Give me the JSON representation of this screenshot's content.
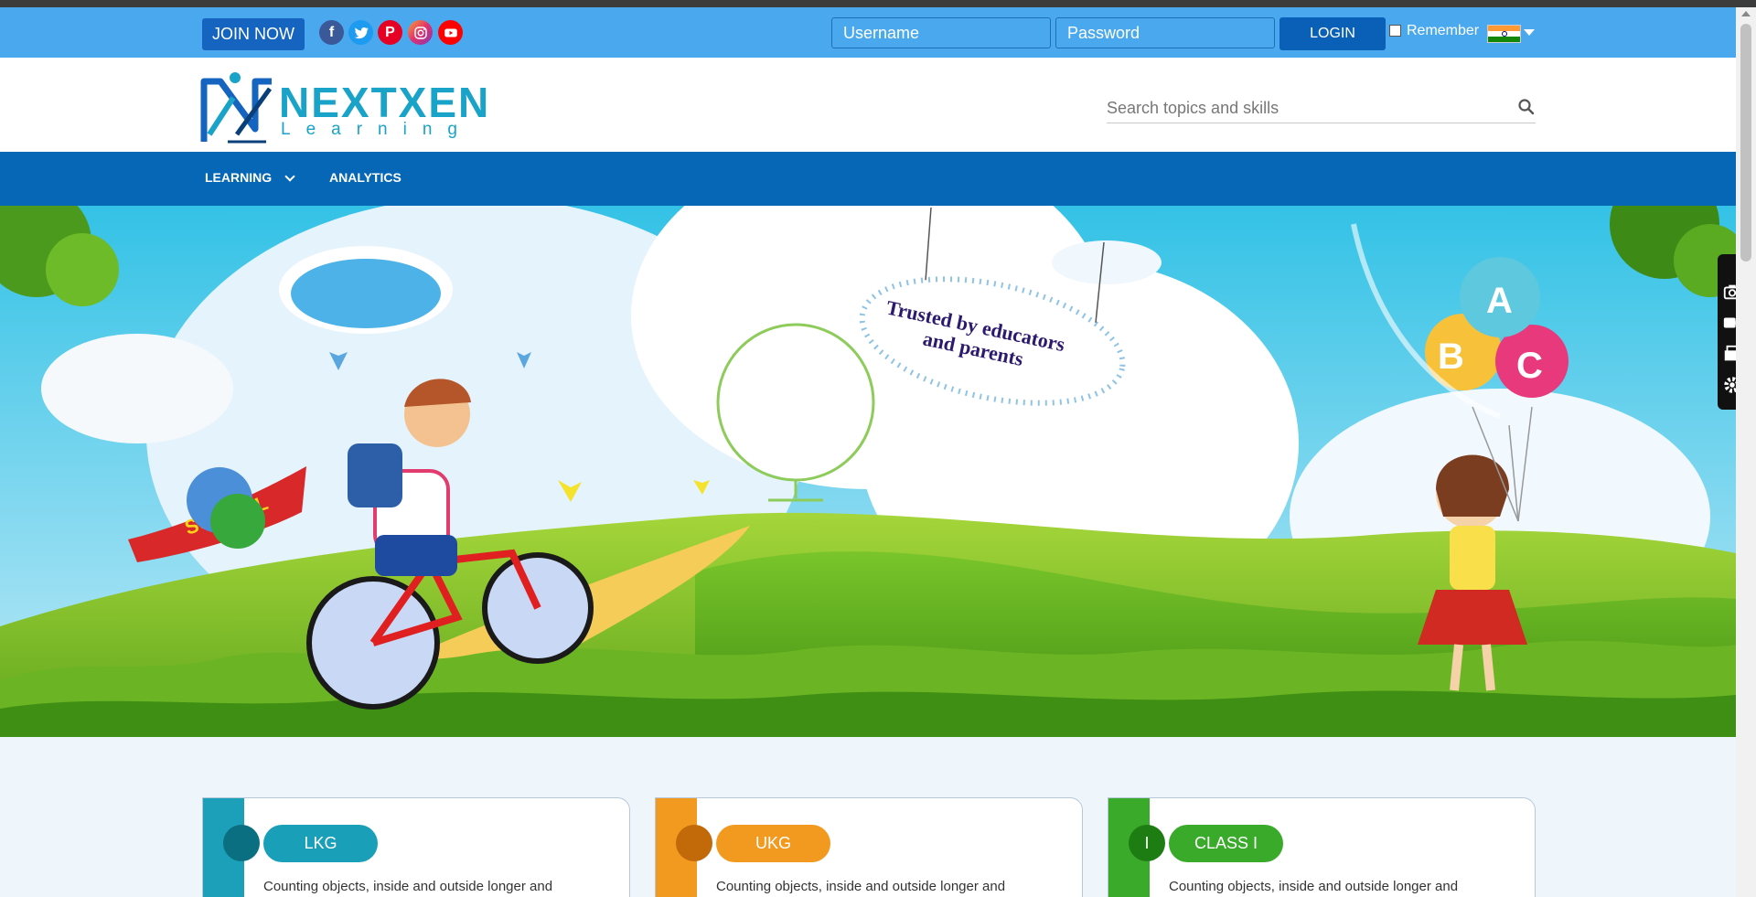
{
  "topbar": {
    "join_label": "JOIN NOW",
    "username_placeholder": "Username",
    "password_placeholder": "Password",
    "login_label": "LOGIN",
    "remember_label": "Remember",
    "social_icons": [
      "facebook-icon",
      "twitter-icon",
      "pinterest-icon",
      "instagram-icon",
      "youtube-icon"
    ]
  },
  "header": {
    "logo_brand": "NEXTXEN",
    "logo_sub": "Learning",
    "search_placeholder": "Search topics and skills"
  },
  "nav": {
    "items": [
      {
        "label": "LEARNING",
        "has_dropdown": true
      },
      {
        "label": "ANALYTICS",
        "has_dropdown": false
      }
    ]
  },
  "banner": {
    "sign_line1": "Trusted by educators",
    "sign_line2": "and parents",
    "flag_text": "SCHOOL",
    "balloon_letters": [
      "A",
      "B",
      "C"
    ]
  },
  "cards": [
    {
      "dot": "",
      "label": "LKG",
      "description": "Counting objects, inside and outside longer and",
      "color": "#1a9fb8"
    },
    {
      "dot": "",
      "label": "UKG",
      "description": "Counting objects, inside and outside longer and",
      "color": "#f29a1f"
    },
    {
      "dot": "I",
      "label": "CLASS I",
      "description": "Counting objects, inside and outside longer and",
      "color": "#3aaa2a"
    }
  ],
  "colors": {
    "topbar": "#4aa8ef",
    "nav": "#0667b6",
    "brand": "#1aa3c8"
  }
}
